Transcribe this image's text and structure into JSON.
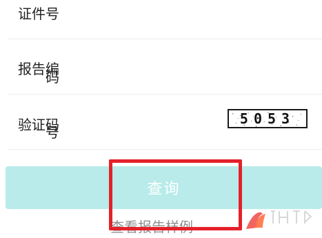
{
  "form": {
    "id_number_label": "证件号",
    "report_number_label_main": "报告编",
    "report_number_label_wrap": "码",
    "captcha_label_main": "验证码",
    "captcha_label_wrap": "号",
    "captcha_code": "5053"
  },
  "actions": {
    "query_label": "查询",
    "sample_link_label": "查看报告样例"
  },
  "colors": {
    "button_fill": "#b8ebea",
    "highlight_border": "#e4212a",
    "divider": "#ececec",
    "text_primary": "#222222",
    "link_text": "#8f8f8f"
  }
}
